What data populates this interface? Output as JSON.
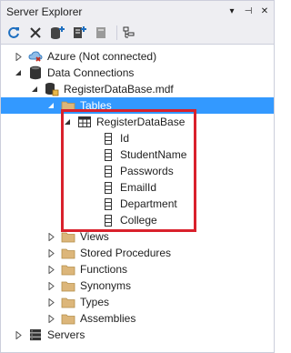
{
  "window": {
    "title": "Server Explorer",
    "controls": [
      "▾",
      "⊣",
      "✕"
    ]
  },
  "toolbar": {
    "buttons": [
      "refresh-icon",
      "stop-icon",
      "add-connection-icon",
      "connect-to-server-icon",
      "connect-sharepoint-icon",
      "properties-icon"
    ]
  },
  "tree": {
    "azure": "Azure (Not connected)",
    "data_connections": "Data Connections",
    "database_file": "RegisterDataBase.mdf",
    "tables": "Tables",
    "table_name": "RegisterDataBase",
    "columns": [
      "Id",
      "StudentName",
      "Passwords",
      "EmailId",
      "Department",
      "College"
    ],
    "views": "Views",
    "stored_procedures": "Stored Procedures",
    "functions": "Functions",
    "synonyms": "Synonyms",
    "types": "Types",
    "assemblies": "Assemblies",
    "servers": "Servers"
  },
  "colors": {
    "selection": "#3399ff",
    "highlight_box": "#d9212c",
    "folder": "#dcb67a"
  }
}
